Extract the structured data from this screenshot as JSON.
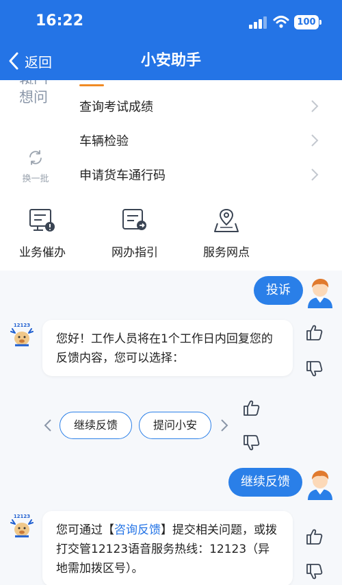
{
  "status_bar": {
    "time": "16:22",
    "battery": "100"
  },
  "nav": {
    "back_label": "返回",
    "title": "小安助手"
  },
  "question_panel": {
    "category_cut_label": "热门",
    "category_label": "想问",
    "items": [
      {
        "label": "查询考试成绩"
      },
      {
        "label": "车辆检验"
      },
      {
        "label": "申请货车通行码"
      }
    ],
    "refresh_label": "换一批"
  },
  "services": [
    {
      "label": "业务催办",
      "icon": "business-reminder-icon"
    },
    {
      "label": "网办指引",
      "icon": "online-guide-icon"
    },
    {
      "label": "服务网点",
      "icon": "service-location-icon"
    }
  ],
  "messages": {
    "user_1": "投诉",
    "bot_1": "您好！工作人员将在1个工作日内回复您的反馈内容，您可以选择：",
    "chips": [
      "继续反馈",
      "提问小安"
    ],
    "user_2": "继续反馈",
    "bot_2_pre": "您可通过【",
    "bot_2_link": "咨询反馈",
    "bot_2_post": "】提交相关问题，或拨打交管12123语音服务热线：12123（异地需加拨区号）。"
  },
  "bot_logo_text": "12123",
  "colors": {
    "header": "#2474e6",
    "accent": "#2a7fe8",
    "indicator": "#f08a24"
  }
}
